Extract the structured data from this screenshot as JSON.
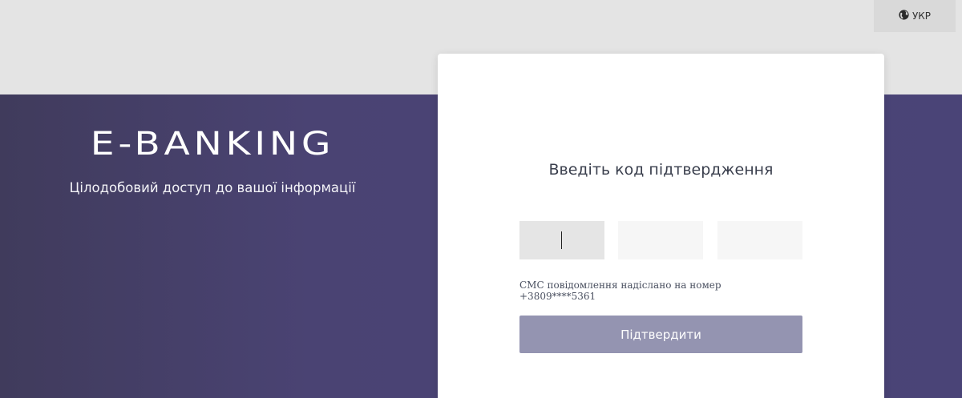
{
  "header": {
    "language_label": "УКР",
    "language_icon": "globe-icon"
  },
  "brand": {
    "title": "E-BANKING",
    "subtitle": "Цілодобовий доступ до вашої інформації"
  },
  "verification": {
    "title": "Введіть код підтвердження",
    "code_fields": [
      {
        "value": ""
      },
      {
        "value": ""
      },
      {
        "value": ""
      }
    ],
    "sms_note_line1": "СМС повідомлення надіслано на номер",
    "sms_note_line2": "+3809****5361",
    "confirm_label": "Підтвердити"
  },
  "colors": {
    "hero_background": "#4a4477",
    "confirm_button": "#9494b1",
    "card_background": "#ffffff"
  }
}
